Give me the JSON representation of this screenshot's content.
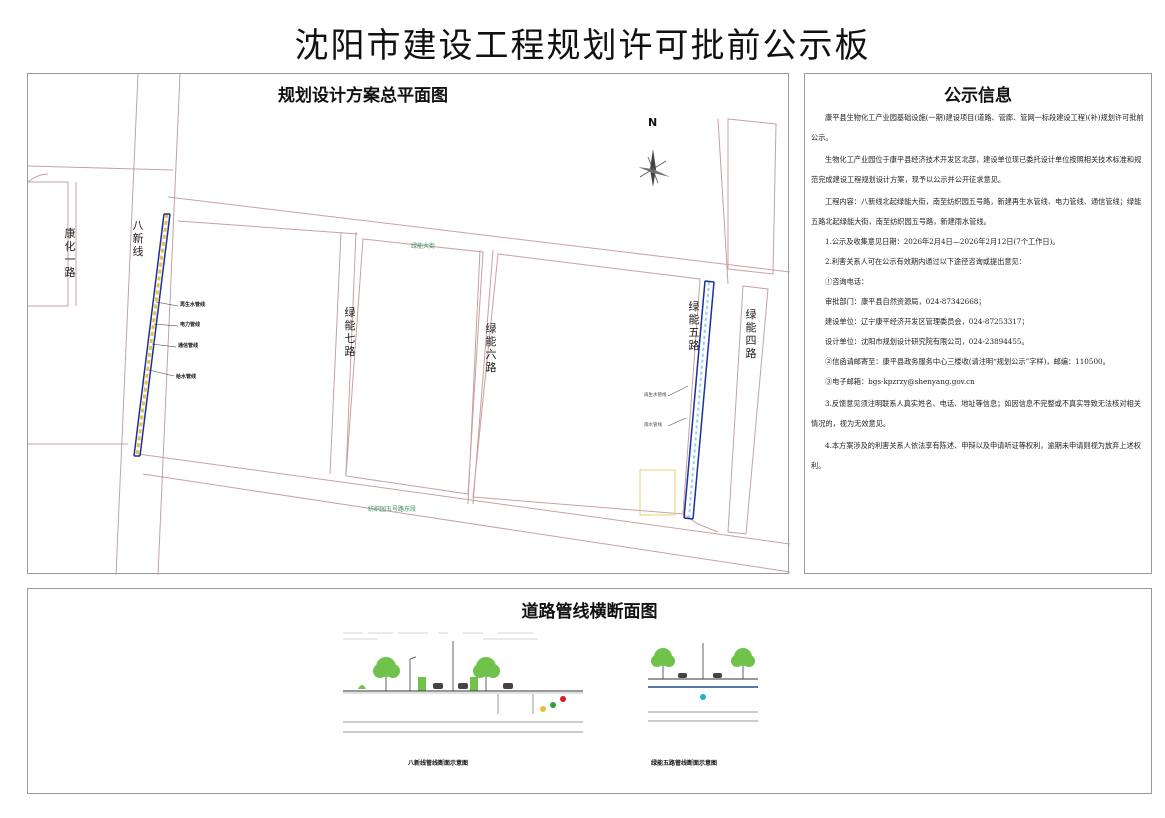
{
  "page_title": "沈阳市建设工程规划许可批前公示板",
  "map": {
    "title": "规划设计方案总平面图",
    "north": "N",
    "roads": {
      "kanghua": "康化一路",
      "baxin": "八新线",
      "lvneng7": "绿能七路",
      "lvneng6": "绿能六路",
      "lvneng5": "绿能五路",
      "lvneng4": "绿能四路",
      "lvneng_dajie": "绿能大街",
      "fangzhi5": "纺织园五号路东段"
    },
    "pipe_labels_left": [
      "再生水管线",
      "电力管线",
      "通信管线",
      "给水管线"
    ],
    "pipe_labels_right": [
      "再生水管线",
      "雨水管线"
    ]
  },
  "info": {
    "title": "公示信息",
    "paragraphs": [
      "康平县生物化工产业园基础设施(一期)建设项目(道路、管廊、管网一标段建设工程)(补)规划许可批前公示。",
      "生物化工产业园位于康平县经济技术开发区北部，建设单位现已委托设计单位按照相关技术标准和规范完成建设工程规划设计方案，现予以公示并公开征求意见。",
      "工程内容：八新线北起绿能大街，南至纺织园五号路，新建再生水管线、电力管线、通信管线；绿能五路北起绿能大街，南至纺织园五号路，新建雨水管线。",
      "1.公示及收集意见日期：2026年2月4日—2026年2月12日(7个工作日)。",
      "2.利害关系人可在公示有效期内通过以下途径咨询或提出意见：",
      "①咨询电话：",
      "审批部门：康平县自然资源局，024-87342668；",
      "建设单位：辽宁康平经济开发区管理委员会，024-87253317；",
      "设计单位：沈阳市规划设计研究院有限公司，024-23894455。",
      "②信函请邮寄至：康平县政务服务中心三楼收(请注明“规划公示”字样)，邮编：110500。",
      "③电子邮箱：bgs-kpzrzy@shenyang.gov.cn",
      "3.反馈意见须注明联系人真实姓名、电话、地址等信息；如因信息不完整或不真实导致无法核对相关情况的，视为无效意见。",
      "4.本方案涉及的利害关系人依法享有陈述、申辩以及申请听证等权利，逾期未申请则视为放弃上述权利。"
    ]
  },
  "section": {
    "title": "道路管线横断面图",
    "caption_left": "八新线管线断面示意图",
    "caption_right": "绿能五路管线断面示意图"
  },
  "colors": {
    "road_line": "#c9a0a0",
    "pipe_blue": "#1a2fa0",
    "pipe_yellow": "#e8c23a",
    "tree_green": "#6fc24a",
    "label_green": "#3a8c5a"
  }
}
